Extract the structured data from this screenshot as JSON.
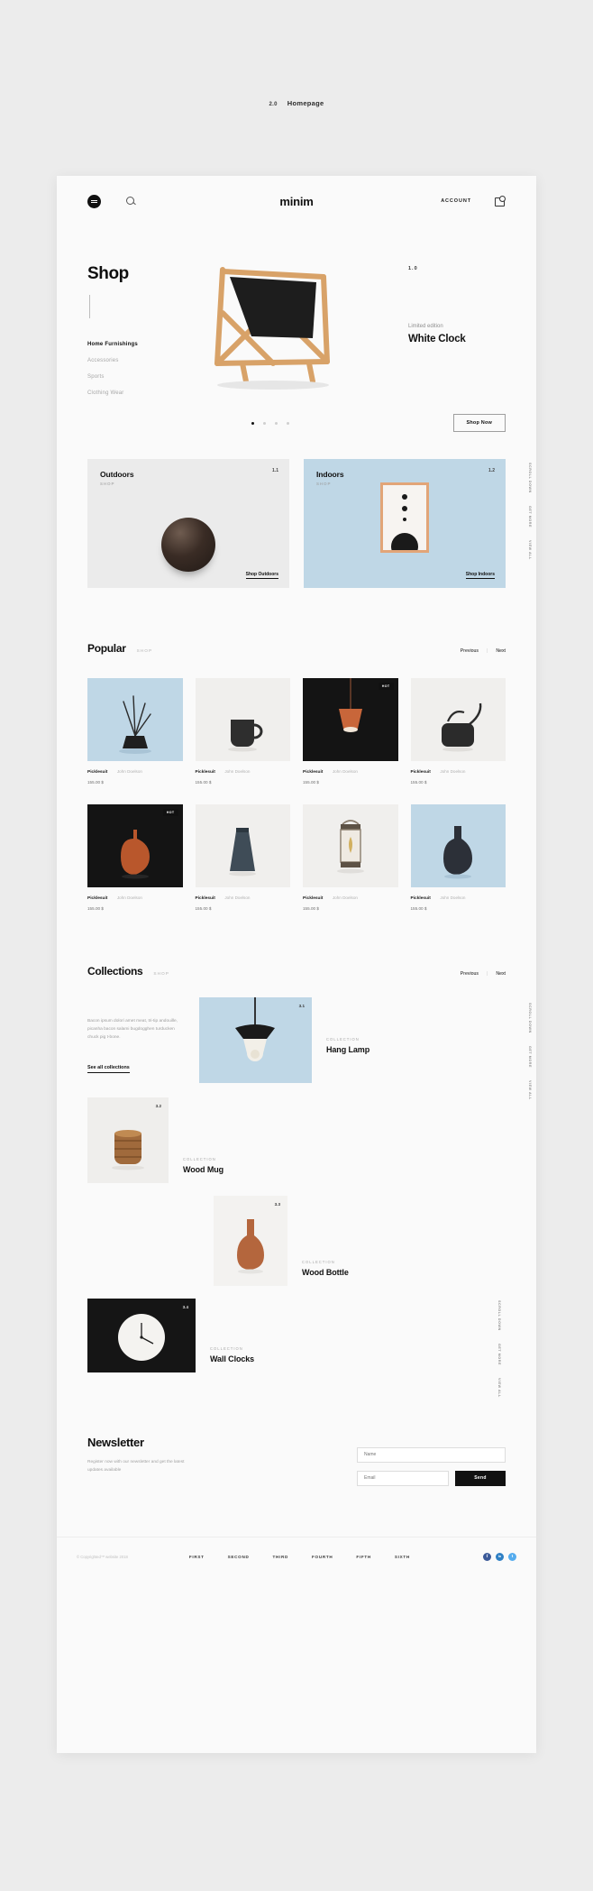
{
  "page_label": {
    "number": "2.0",
    "title": "Homepage"
  },
  "nav": {
    "menu_icon": "hamburger-icon",
    "search_icon": "search-icon",
    "logo": "minim",
    "account_label": "ACCOUNT",
    "cart_icon": "shopping-bag-icon"
  },
  "hero": {
    "title": "Shop",
    "categories": [
      {
        "label": "Home Furnishings",
        "active": true
      },
      {
        "label": "Accessories",
        "active": false
      },
      {
        "label": "Sports",
        "active": false
      },
      {
        "label": "Clothing Wear",
        "active": false
      }
    ],
    "slide_number": "1.0",
    "eyebrow": "Limited edition",
    "product": "White Clock",
    "cta": "Shop Now",
    "dots": 4,
    "active_dot": 0
  },
  "category_cards": [
    {
      "badge": "1.1",
      "title": "Outdoors",
      "subtitle": "SHOP",
      "link": "Shop Outdoors",
      "bg": "#ebebeb",
      "art": "sphere"
    },
    {
      "badge": "1.2",
      "title": "Indoors",
      "subtitle": "SHOP",
      "link": "Shop Indoors",
      "bg": "#bfd7e6",
      "art": "poster"
    }
  ],
  "side_notes_top": [
    "SCROLL DOWN",
    "GET MORE",
    "VIEW ALL"
  ],
  "side_notes_mid": [
    "SCROLL DOWN",
    "GET MORE",
    "VIEW ALL"
  ],
  "side_notes_bottom": [
    "SCROLL DOWN",
    "GET MORE",
    "VIEW ALL"
  ],
  "popular": {
    "title": "Popular",
    "tag": "SHOP",
    "previous": "Previous",
    "next": "Next",
    "separator": "|",
    "products": [
      {
        "name": "Picklesuit",
        "author": "John Doelson",
        "price": "155.00 $",
        "bg": "#bfd7e6",
        "art": "diffuser",
        "badge": ""
      },
      {
        "name": "Picklesuit",
        "author": "John Doelson",
        "price": "155.00 $",
        "bg": "#f0efed",
        "art": "mug",
        "badge": ""
      },
      {
        "name": "Picklesuit",
        "author": "John Doelson",
        "price": "155.00 $",
        "bg": "#141414",
        "art": "pendant",
        "badge": "HOT"
      },
      {
        "name": "Picklesuit",
        "author": "John Doelson",
        "price": "155.00 $",
        "bg": "#f0efed",
        "art": "kettle",
        "badge": ""
      },
      {
        "name": "Picklesuit",
        "author": "John Doelson",
        "price": "155.00 $",
        "bg": "#141414",
        "art": "vase",
        "badge": "HOT"
      },
      {
        "name": "Picklesuit",
        "author": "John Doelson",
        "price": "155.00 $",
        "bg": "#f0efed",
        "art": "cone",
        "badge": ""
      },
      {
        "name": "Picklesuit",
        "author": "John Doelson",
        "price": "155.00 $",
        "bg": "#f0efed",
        "art": "lantern",
        "badge": ""
      },
      {
        "name": "Picklesuit",
        "author": "John Doelson",
        "price": "155.00 $",
        "bg": "#bfd7e6",
        "art": "bottle",
        "badge": ""
      }
    ]
  },
  "collections": {
    "title": "Collections",
    "tag": "SHOP",
    "previous": "Previous",
    "next": "Next",
    "separator": "|",
    "description": "Bacon ipsum dolori amet meat, tri-tip andouille, picanha bacon salami bugdogghen turducken chuck pig t-bone.",
    "see_all": "See all collections",
    "items": [
      {
        "number": "3.1",
        "label": "COLLECTION",
        "name": "Hang Lamp",
        "bg": "#bfd7e6",
        "art": "lamp"
      },
      {
        "number": "3.2",
        "label": "COLLECTION",
        "name": "Wood Mug",
        "bg": "#efeeec",
        "art": "woodmug"
      },
      {
        "number": "3.3",
        "label": "COLLECTION",
        "name": "Wood Bottle",
        "bg": "#f3f2f0",
        "art": "woodbottle"
      },
      {
        "number": "3.4",
        "label": "COLLECTION",
        "name": "Wall Clocks",
        "bg": "#151515",
        "art": "clock"
      }
    ]
  },
  "newsletter": {
    "title": "Newsletter",
    "description": "Register now with our newsletter and get the latest updates available",
    "name_placeholder": "Name",
    "email_placeholder": "Email",
    "send_label": "Send"
  },
  "footer": {
    "copyright": "© Copyrighted™ website 2018",
    "links": [
      "FIRST",
      "SECOND",
      "THIRD",
      "FOURTH",
      "FIFTH",
      "SIXTH"
    ],
    "socials": [
      {
        "icon": "facebook-icon",
        "glyph": "f",
        "color": "#3b5998"
      },
      {
        "icon": "linkedin-icon",
        "glyph": "in",
        "color": "#2f80c4"
      },
      {
        "icon": "twitter-icon",
        "glyph": "t",
        "color": "#55acee"
      }
    ]
  }
}
